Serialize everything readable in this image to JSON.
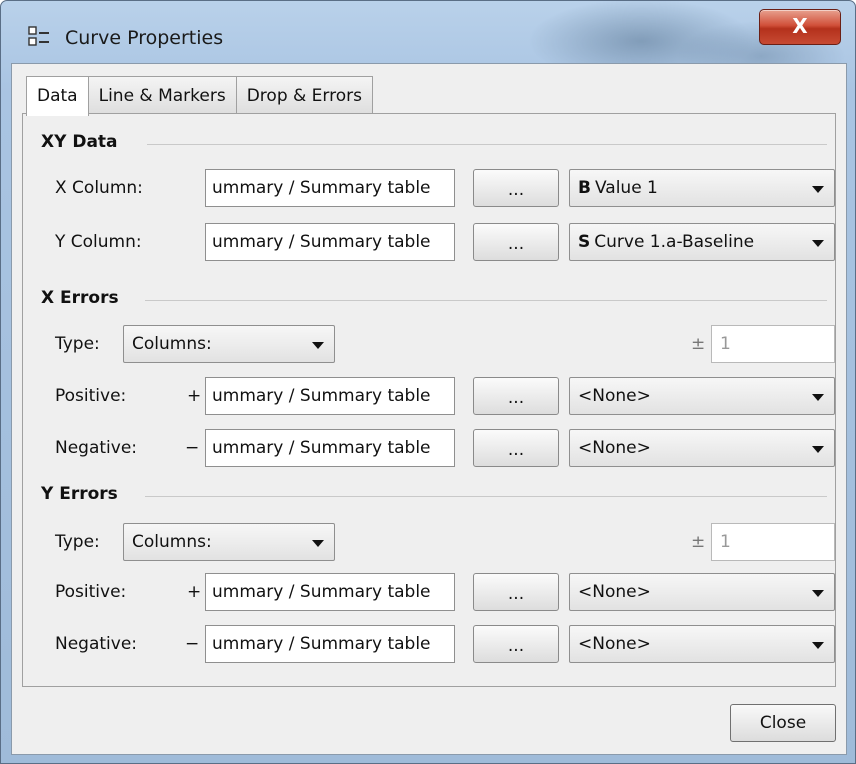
{
  "window": {
    "title": "Curve Properties",
    "close_glyph": "X"
  },
  "tabs": [
    {
      "label": "Data",
      "active": true
    },
    {
      "label": "Line & Markers",
      "active": false
    },
    {
      "label": "Drop & Errors",
      "active": false
    }
  ],
  "xy_data": {
    "title": "XY Data",
    "x_column": {
      "label": "X Column:",
      "source": "ummary / Summary table",
      "browse": "...",
      "selected_prefix": "B",
      "selected": "Value 1"
    },
    "y_column": {
      "label": "Y Column:",
      "source": "ummary / Summary table",
      "browse": "...",
      "selected_prefix": "S",
      "selected": "Curve 1.a-Baseline"
    }
  },
  "x_errors": {
    "title": "X Errors",
    "type_label": "Type:",
    "type_value": "Columns:",
    "plus_minus": "±",
    "value": "1",
    "positive": {
      "label": "Positive:",
      "sign": "+",
      "source": "ummary / Summary table",
      "browse": "...",
      "selected": "<None>"
    },
    "negative": {
      "label": "Negative:",
      "sign": "−",
      "source": "ummary / Summary table",
      "browse": "...",
      "selected": "<None>"
    }
  },
  "y_errors": {
    "title": "Y Errors",
    "type_label": "Type:",
    "type_value": "Columns:",
    "plus_minus": "±",
    "value": "1",
    "positive": {
      "label": "Positive:",
      "sign": "+",
      "source": "ummary / Summary table",
      "browse": "...",
      "selected": "<None>"
    },
    "negative": {
      "label": "Negative:",
      "sign": "−",
      "source": "ummary / Summary table",
      "browse": "...",
      "selected": "<None>"
    }
  },
  "footer": {
    "close_label": "Close"
  },
  "colors": {
    "titlebar": "#a9c4e2",
    "close_red": "#c74a33",
    "dialog_bg": "#efefef"
  },
  "icons": {
    "app": "properties-list-icon",
    "dropdown": "chevron-down-icon"
  }
}
